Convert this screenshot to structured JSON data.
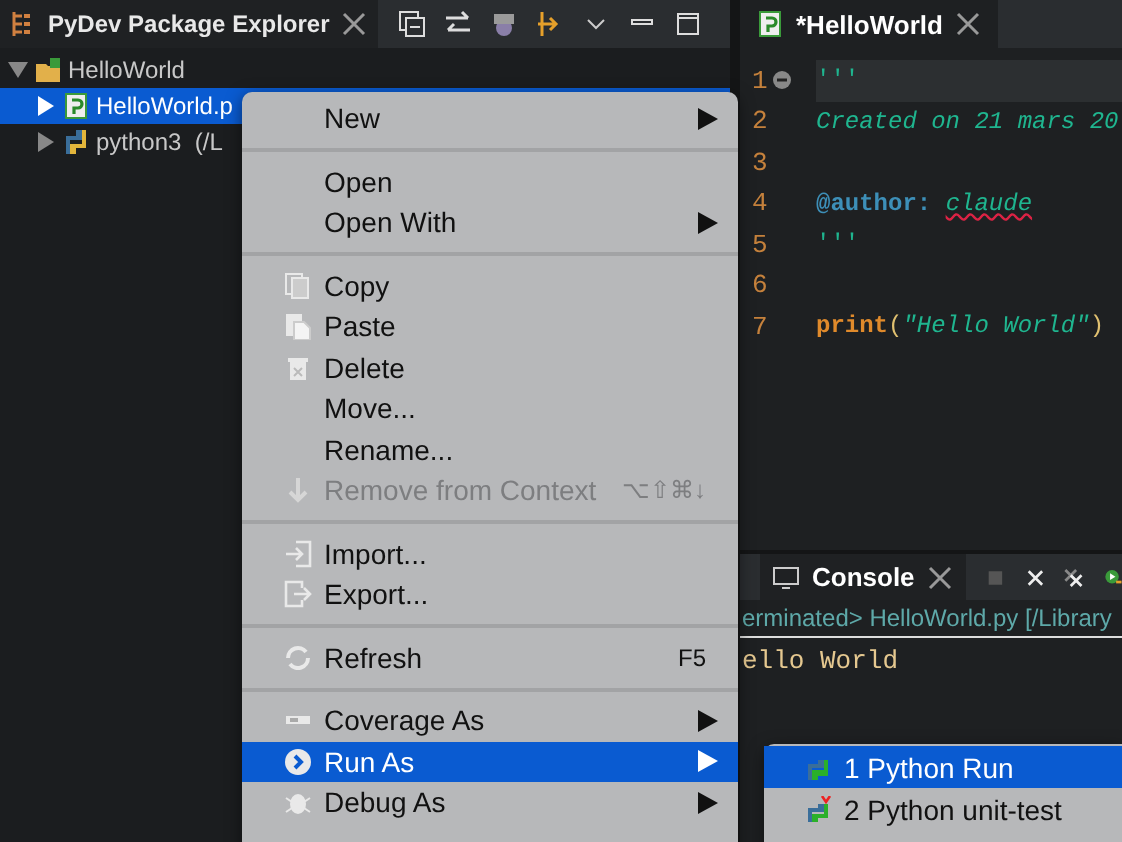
{
  "explorer": {
    "title": "PyDev Package Explorer",
    "tree": [
      {
        "label": "HelloWorld",
        "kind": "project",
        "expanded": true,
        "selected": false,
        "children": [
          {
            "label": "HelloWorld.p",
            "kind": "file",
            "expanded": false,
            "selected": true
          },
          {
            "label": "python3  (/L",
            "kind": "interpreter",
            "expanded": false,
            "selected": false
          }
        ]
      }
    ]
  },
  "editor": {
    "tab": "*HelloWorld",
    "lines": [
      {
        "number": "1",
        "current": true,
        "folder": true,
        "parts": [
          {
            "kind": "string",
            "text": "'''"
          }
        ]
      },
      {
        "number": "2",
        "current": false,
        "folder": false,
        "parts": [
          {
            "kind": "doc",
            "text": "Created on 21 mars 20"
          }
        ]
      },
      {
        "number": "3",
        "current": false,
        "folder": false
      },
      {
        "number": "4",
        "current": false,
        "folder": false,
        "parts": [
          {
            "kind": "decorator",
            "text": "@author: "
          },
          {
            "kind": "misspelled",
            "text": "claude"
          }
        ]
      },
      {
        "number": "5",
        "current": false,
        "folder": false,
        "parts": [
          {
            "kind": "string",
            "text": "'''"
          }
        ]
      },
      {
        "number": "6",
        "current": false,
        "folder": false
      },
      {
        "number": "7",
        "current": false,
        "folder": false,
        "parts": [
          {
            "kind": "keyword",
            "text": "print"
          },
          {
            "kind": "plain",
            "text": "("
          },
          {
            "kind": "doc",
            "text": "\"Hello World\""
          },
          {
            "kind": "plain",
            "text": ")"
          }
        ]
      }
    ]
  },
  "console": {
    "tab": "Console",
    "status": "erminated> HelloWorld.py [/Library",
    "output": "ello World"
  },
  "context_menu": {
    "items": [
      {
        "kind": "item",
        "label": "New",
        "submenu": true,
        "disabled": false,
        "selected": false
      },
      {
        "kind": "separator"
      },
      {
        "kind": "item",
        "label": "Open",
        "submenu": false,
        "disabled": false,
        "selected": false
      },
      {
        "kind": "item",
        "label": "Open With",
        "submenu": true,
        "disabled": false,
        "selected": false
      },
      {
        "kind": "separator"
      },
      {
        "kind": "item",
        "label": "Copy",
        "submenu": false,
        "disabled": false,
        "selected": false
      },
      {
        "kind": "item",
        "label": "Paste",
        "submenu": false,
        "disabled": false,
        "selected": false
      },
      {
        "kind": "item",
        "label": "Delete",
        "submenu": false,
        "disabled": false,
        "selected": false
      },
      {
        "kind": "item",
        "label": "Move...",
        "submenu": false,
        "disabled": false,
        "selected": false
      },
      {
        "kind": "item",
        "label": "Rename...",
        "submenu": false,
        "disabled": false,
        "selected": false
      },
      {
        "kind": "item",
        "label": "Remove from Context",
        "shortcut": "⌥⇧⌘↓",
        "submenu": false,
        "disabled": true,
        "selected": false
      },
      {
        "kind": "separator"
      },
      {
        "kind": "item",
        "label": "Import...",
        "submenu": false,
        "disabled": false,
        "selected": false
      },
      {
        "kind": "item",
        "label": "Export...",
        "submenu": false,
        "disabled": false,
        "selected": false
      },
      {
        "kind": "separator"
      },
      {
        "kind": "item",
        "label": "Refresh",
        "shortcut": "F5",
        "submenu": false,
        "disabled": false,
        "selected": false
      },
      {
        "kind": "separator"
      },
      {
        "kind": "item",
        "label": "Coverage As",
        "submenu": true,
        "disabled": false,
        "selected": false
      },
      {
        "kind": "item",
        "label": "Run As",
        "submenu": true,
        "disabled": false,
        "selected": true
      },
      {
        "kind": "item",
        "label": "Debug As",
        "submenu": true,
        "disabled": false,
        "selected": false
      }
    ]
  },
  "run_as_menu": {
    "items": [
      {
        "label": "1 Python Run",
        "kind": "run",
        "selected": true
      },
      {
        "label": "2 Python unit-test",
        "kind": "test",
        "selected": false
      }
    ]
  }
}
